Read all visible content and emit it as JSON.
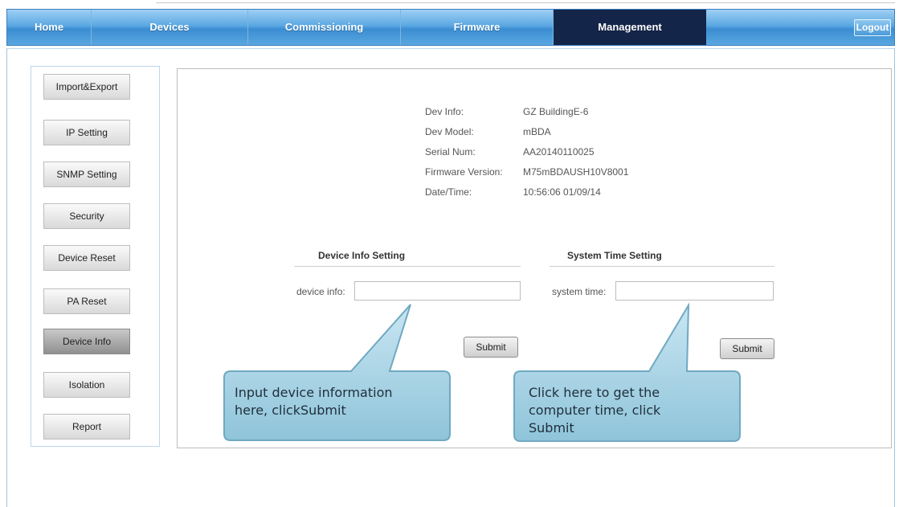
{
  "nav": {
    "home": "Home",
    "devices": "Devices",
    "commissioning": "Commissioning",
    "firmware": "Firmware",
    "management": "Management",
    "logout": "Logout"
  },
  "sidebar": {
    "items": [
      {
        "label": "Import&Export"
      },
      {
        "label": "IP Setting"
      },
      {
        "label": "SNMP Setting"
      },
      {
        "label": "Security"
      },
      {
        "label": "Device Reset"
      },
      {
        "label": "PA Reset"
      },
      {
        "label": "Device Info",
        "active": true
      },
      {
        "label": "Isolation"
      },
      {
        "label": "Report"
      }
    ]
  },
  "device_info": {
    "dev_info_label": "Dev Info:",
    "dev_info_value": "GZ BuildingE-6",
    "dev_model_label": "Dev Model:",
    "dev_model_value": "mBDA",
    "serial_label": "Serial Num:",
    "serial_value": "AA20140110025",
    "firmware_label": "Firmware Version:",
    "firmware_value": "M75mBDAUSH10V8001",
    "datetime_label": "Date/Time:",
    "datetime_value": "10:56:06 01/09/14"
  },
  "device_info_setting": {
    "title": "Device Info Setting",
    "field_label": "device info:",
    "value": "",
    "submit": "Submit"
  },
  "system_time_setting": {
    "title": "System Time Setting",
    "field_label": "system time:",
    "value": "",
    "submit": "Submit"
  },
  "callouts": {
    "left_line1": "Input device information",
    "left_line2": "here, clickSubmit",
    "right_line1": "Click here to get the",
    "right_line2": "computer time, click",
    "right_line3": "Submit"
  },
  "colors": {
    "nav_active": "#14254a",
    "nav_bar": "#4b9bd9",
    "callout_fill": "#a9d3e4"
  }
}
